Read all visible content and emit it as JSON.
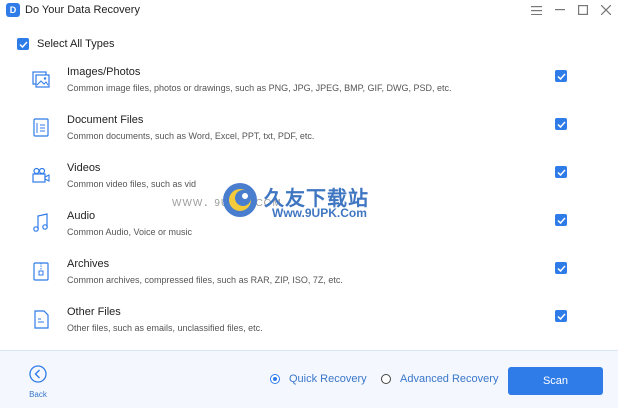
{
  "window": {
    "title": "Do Your Data Recovery",
    "icon": "app-logo-icon"
  },
  "select_all": {
    "label": "Select All Types",
    "checked": true
  },
  "file_types": [
    {
      "name": "Images/Photos",
      "description": "Common image files, photos or drawings, such as PNG, JPG, JPEG, BMP, GIF, DWG, PSD, etc.",
      "icon": "image-icon",
      "checked": true
    },
    {
      "name": "Document Files",
      "description": "Common documents, such as Word, Excel, PPT, txt, PDF, etc.",
      "icon": "document-icon",
      "checked": true
    },
    {
      "name": "Videos",
      "description": "Common video files, such as vid",
      "icon": "video-icon",
      "checked": true
    },
    {
      "name": "Audio",
      "description": "Common Audio, Voice or music",
      "icon": "audio-icon",
      "checked": true
    },
    {
      "name": "Archives",
      "description": "Common archives, compressed files, such as RAR, ZIP, ISO, 7Z, etc.",
      "icon": "archive-icon",
      "checked": true
    },
    {
      "name": "Other Files",
      "description": "Other files, such as emails, unclassified files, etc.",
      "icon": "other-file-icon",
      "checked": true
    }
  ],
  "watermark": {
    "brand": "久友下载站",
    "url_small": "WWW．9UPK．COM",
    "url": "Www.9UPK.Com"
  },
  "footer": {
    "back_label": "Back",
    "quick_recovery": "Quick Recovery",
    "advanced_recovery": "Advanced Recovery",
    "selected_mode": "quick",
    "scan_label": "Scan"
  },
  "colors": {
    "accent": "#2f7be8",
    "footer_bg": "#f4f8fe",
    "link": "#3a76c9"
  }
}
